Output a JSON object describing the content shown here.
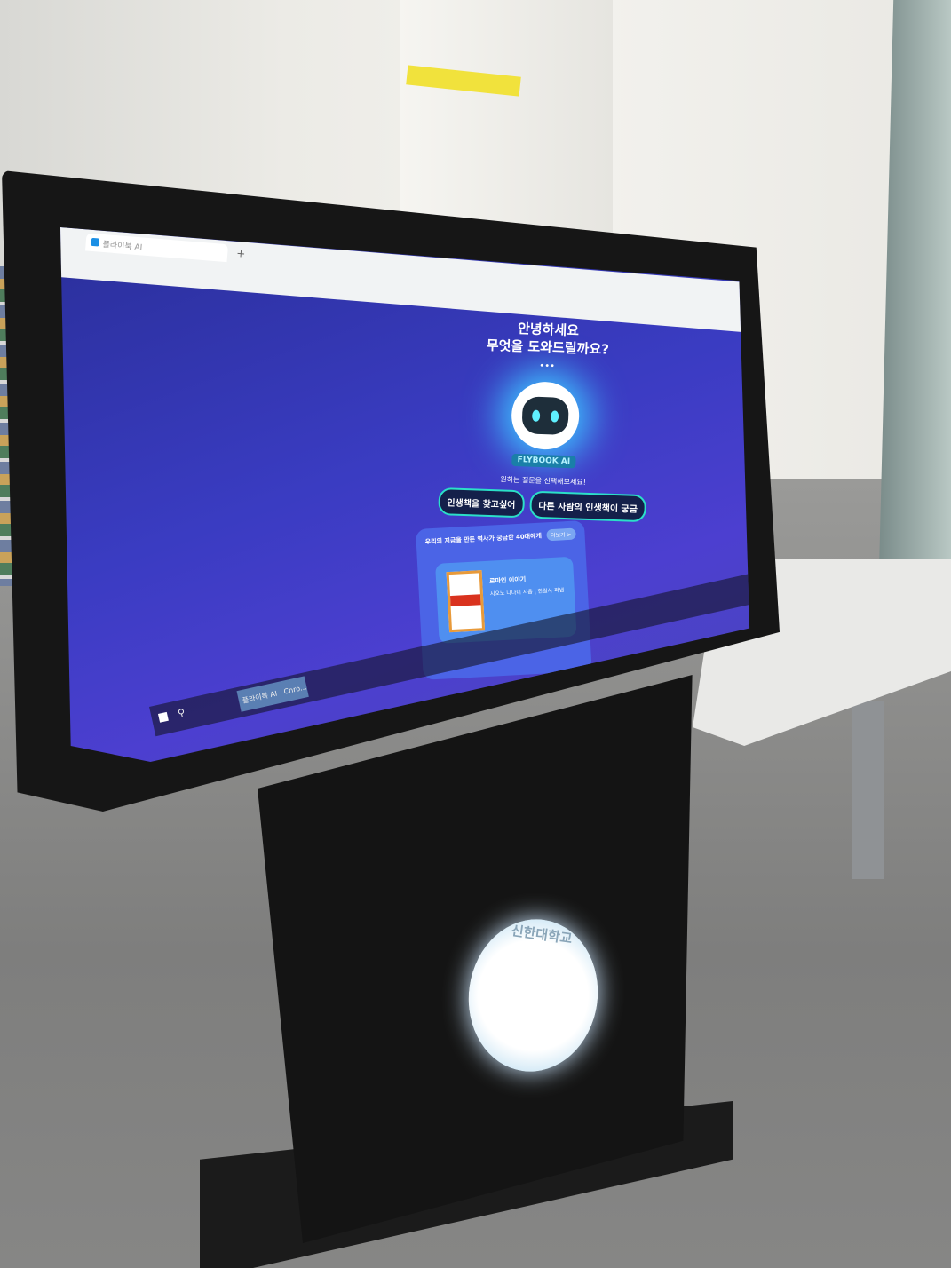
{
  "browser": {
    "tab_title": "플라이북 AI",
    "new_tab": "+"
  },
  "app": {
    "greeting_line1": "안녕하세요",
    "greeting_line2": "무엇을 도와드릴까요?",
    "typing_indicator": "•••",
    "brand": "FLYBOOK AI",
    "prompt": "원하는 질문을 선택해보세요!",
    "questions": [
      "인생책을 찾고싶어",
      "다른 사람의 인생책이 궁금"
    ],
    "card": {
      "title": "우리의 지금을 만든 역사가 궁금한 40대에게",
      "more": "더보기 >",
      "book_title": "로마인 이야기",
      "book_meta": "시오노 나나미 지음 | 한길사 펴냄"
    }
  },
  "taskbar": {
    "app": "플라이북 AI - Chro..."
  },
  "kiosk": {
    "seal_text": "신한대학교"
  },
  "colors": {
    "screen_bg": "#3a3cc2",
    "accent": "#2be0c8",
    "card": "#4b64e6"
  }
}
